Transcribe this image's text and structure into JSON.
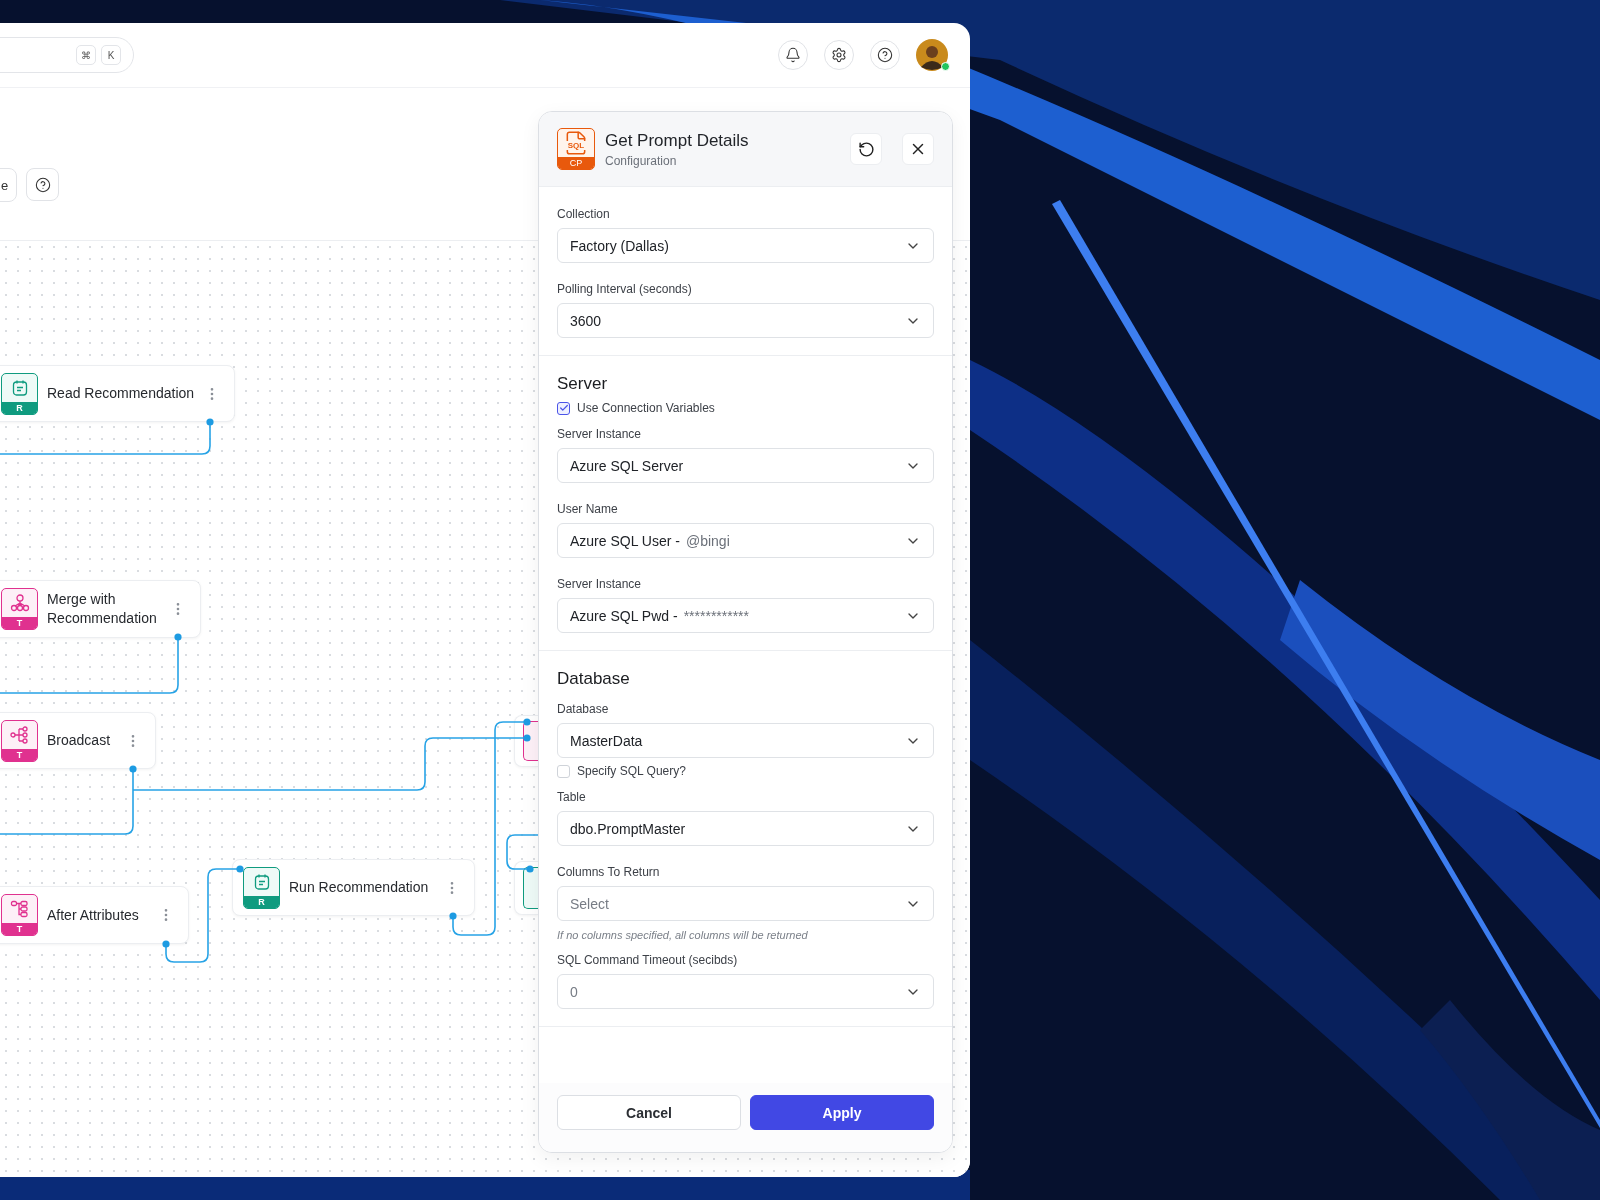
{
  "search": {
    "shortcut_keys": [
      "⌘",
      "K"
    ]
  },
  "user": {
    "online": true
  },
  "toolbar": {
    "button_label": "e"
  },
  "nodes": [
    {
      "label": "Read Recommendation",
      "kind": "read",
      "badge": "R"
    },
    {
      "label": "Merge with Recommendation",
      "kind": "merge",
      "badge": "T"
    },
    {
      "label": "Broadcast",
      "kind": "broadcast",
      "badge": "T"
    },
    {
      "label": "After Attributes",
      "kind": "attributes",
      "badge": "T"
    },
    {
      "label": "Run Recommendation",
      "kind": "read",
      "badge": "R"
    },
    {
      "kind": "broadcast"
    },
    {
      "kind": "read"
    }
  ],
  "panel": {
    "title": "Get Prompt Details",
    "subtitle": "Configuration",
    "file_label": "SQL",
    "badge": "CP",
    "sections": [
      {
        "fields": [
          {
            "kind": "select",
            "label": "Collection",
            "value": "Factory (Dallas)"
          },
          {
            "kind": "select",
            "label": "Polling Interval (seconds)",
            "value": "3600"
          }
        ]
      },
      {
        "heading": "Server",
        "fields": [
          {
            "kind": "checkbox",
            "label": "Use Connection Variables",
            "checked": true
          },
          {
            "kind": "select",
            "label": "Server Instance",
            "value": "Azure SQL Server"
          },
          {
            "kind": "select",
            "label": "User Name",
            "value": "Azure SQL User -",
            "suffix": "@bingi"
          },
          {
            "kind": "select",
            "label": "Server Instance",
            "value": "Azure SQL Pwd -",
            "suffix": "************"
          }
        ]
      },
      {
        "heading": "Database",
        "fields": [
          {
            "kind": "select",
            "label": "Database",
            "value": "MasterData"
          },
          {
            "kind": "checkbox",
            "label": "Specify SQL Query?",
            "checked": false
          },
          {
            "kind": "select",
            "label": "Table",
            "value": "dbo.PromptMaster"
          },
          {
            "kind": "select",
            "label": "Columns To Return",
            "placeholder": "Select"
          },
          {
            "kind": "hint",
            "text": "If no columns specified, all columns will be returned"
          },
          {
            "kind": "select",
            "label": "SQL Command Timeout (secibds)",
            "placeholder": "0"
          }
        ]
      }
    ],
    "buttons": [
      {
        "label": "Cancel",
        "kind": "secondary"
      },
      {
        "label": "Apply",
        "kind": "primary"
      }
    ]
  }
}
